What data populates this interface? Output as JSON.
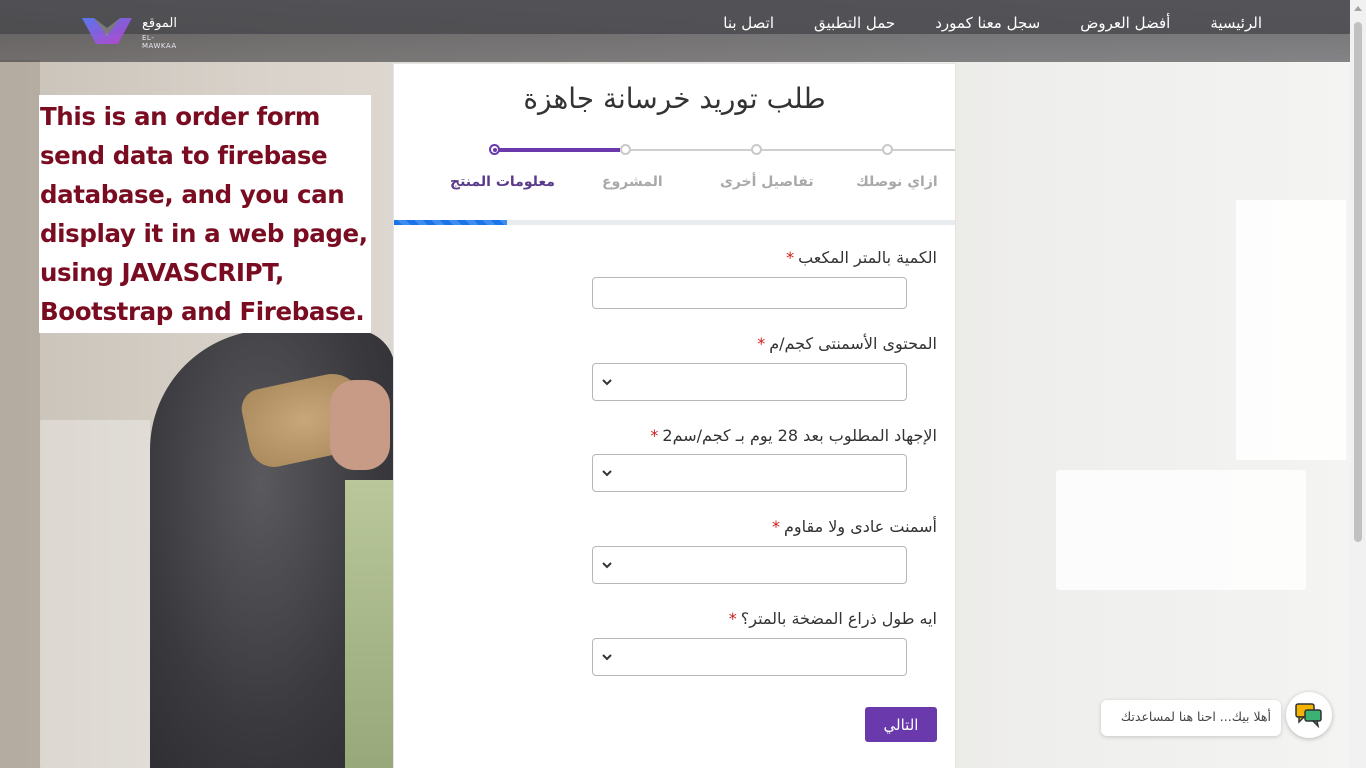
{
  "logo": {
    "text_ar": "الموقع",
    "text_en": "EL-MAWKAA"
  },
  "nav": {
    "items": [
      {
        "label": "الرئيسية"
      },
      {
        "label": "أفضل العروض"
      },
      {
        "label": "سجل معنا كمورد"
      },
      {
        "label": "حمل التطبيق"
      },
      {
        "label": "اتصل بنا"
      }
    ]
  },
  "note": {
    "text": "This is an order form send data to firebase database, and you can display it in a web page, using JAVASCRIPT, Bootstrap and Firebase."
  },
  "form": {
    "title": "طلب توريد خرسانة جاهزة",
    "steps": [
      {
        "label": "معلومات المنتج",
        "active": true
      },
      {
        "label": "المشروع",
        "active": false
      },
      {
        "label": "تفاصيل أخرى",
        "active": false
      },
      {
        "label": "ازاي نوصلك",
        "active": false
      }
    ],
    "progress_fraction": 0.2,
    "fields": [
      {
        "label": "الكمية بالمتر المكعب",
        "required_mark": "*",
        "type": "text",
        "value": ""
      },
      {
        "label": "المحتوى الأسمنتى كجم/م",
        "required_mark": "*",
        "type": "select",
        "value": ""
      },
      {
        "label": "الإجهاد المطلوب بعد 28 يوم بـ كجم/سم2",
        "required_mark": "*",
        "type": "select",
        "value": ""
      },
      {
        "label": "أسمنت عادى ولا مقاوم",
        "required_mark": "*",
        "type": "select",
        "value": ""
      },
      {
        "label": "ايه طول ذراع المضخة بالمتر؟",
        "required_mark": "*",
        "type": "select",
        "value": ""
      }
    ],
    "next_label": "التالي"
  },
  "chat": {
    "greeting": "أهلا بيك... احنا هنا لمساعدتك",
    "icon": "chat-bubble-icon"
  },
  "colors": {
    "accent": "#6a3aad",
    "note_text": "#7a0c22",
    "required": "#d01818",
    "progress": "#1a73e8"
  }
}
